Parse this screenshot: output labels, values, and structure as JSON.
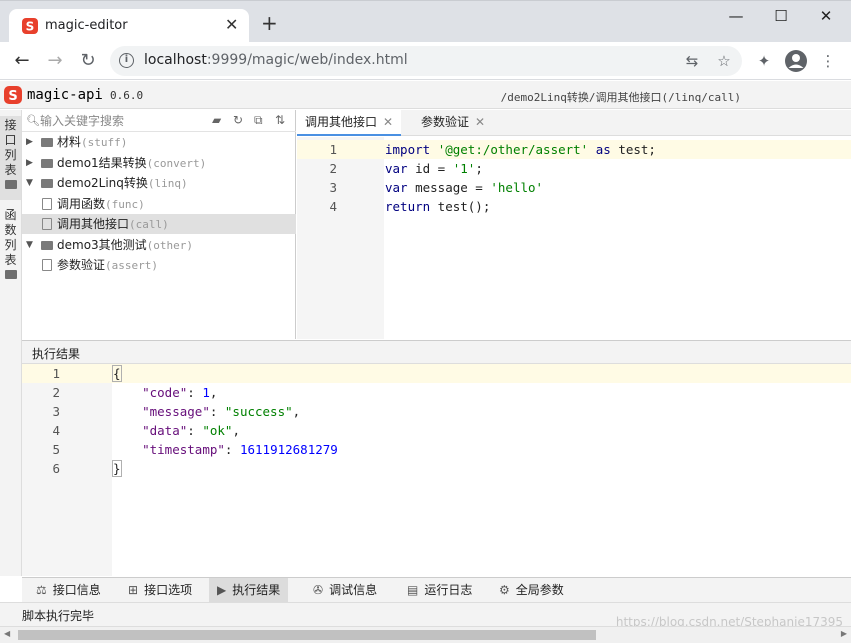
{
  "browser": {
    "tab_title": "magic-editor",
    "tab_close": "✕",
    "new_tab": "+",
    "minimize": "—",
    "maximize": "☐",
    "close": "✕",
    "url_host": "localhost",
    "url_rest": ":9999/magic/web/index.html"
  },
  "app": {
    "name": "magic-api",
    "version": "0.6.0",
    "path": "/demo2Linq转换/调用其他接口(/linq/call)"
  },
  "sidebar": {
    "tab_interfaces": [
      "接",
      "口",
      "列",
      "表"
    ],
    "tab_functions": [
      "函",
      "数",
      "列",
      "表"
    ]
  },
  "tree": {
    "search_placeholder": "输入关键字搜索",
    "items": [
      {
        "label": "材料",
        "sub": "(stuff)",
        "type": "folder",
        "expanded": false,
        "selected": false
      },
      {
        "label": "demo1结果转换",
        "sub": "(convert)",
        "type": "folder",
        "expanded": false,
        "selected": false
      },
      {
        "label": "demo2Linq转换",
        "sub": "(linq)",
        "type": "folder",
        "expanded": true,
        "selected": false
      },
      {
        "label": "调用函数",
        "sub": "(func)",
        "type": "file",
        "expanded": false,
        "selected": false
      },
      {
        "label": "调用其他接口",
        "sub": "(call)",
        "type": "file",
        "expanded": false,
        "selected": true
      },
      {
        "label": "demo3其他测试",
        "sub": "(other)",
        "type": "folder",
        "expanded": true,
        "selected": false
      },
      {
        "label": "参数验证",
        "sub": "(assert)",
        "type": "file",
        "expanded": false,
        "selected": false
      }
    ]
  },
  "editor": {
    "tabs": [
      {
        "label": "调用其他接口",
        "close": "✕",
        "active": true
      },
      {
        "label": "参数验证",
        "close": "✕",
        "active": false
      }
    ],
    "lines": [
      [
        {
          "t": "import ",
          "c": "kw"
        },
        {
          "t": "'@get:/other/assert'",
          "c": "str"
        },
        {
          "t": " ",
          "c": ""
        },
        {
          "t": "as",
          "c": "kw"
        },
        {
          "t": " test;",
          "c": ""
        }
      ],
      [
        {
          "t": "var",
          "c": "kw"
        },
        {
          "t": " id = ",
          "c": ""
        },
        {
          "t": "'1'",
          "c": "str"
        },
        {
          "t": ";",
          "c": ""
        }
      ],
      [
        {
          "t": "var",
          "c": "kw"
        },
        {
          "t": " message = ",
          "c": ""
        },
        {
          "t": "'hello'",
          "c": "str"
        }
      ],
      [
        {
          "t": "return",
          "c": "kw"
        },
        {
          "t": " test();",
          "c": ""
        }
      ]
    ]
  },
  "result": {
    "header": "执行结果",
    "lines": [
      [
        {
          "t": "{",
          "c": "brk"
        }
      ],
      [
        {
          "t": "    ",
          "c": ""
        },
        {
          "t": "\"code\"",
          "c": "key"
        },
        {
          "t": ": ",
          "c": ""
        },
        {
          "t": "1",
          "c": "num"
        },
        {
          "t": ",",
          "c": ""
        }
      ],
      [
        {
          "t": "    ",
          "c": ""
        },
        {
          "t": "\"message\"",
          "c": "key"
        },
        {
          "t": ": ",
          "c": ""
        },
        {
          "t": "\"success\"",
          "c": "str"
        },
        {
          "t": ",",
          "c": ""
        }
      ],
      [
        {
          "t": "    ",
          "c": ""
        },
        {
          "t": "\"data\"",
          "c": "key"
        },
        {
          "t": ": ",
          "c": ""
        },
        {
          "t": "\"ok\"",
          "c": "str"
        },
        {
          "t": ",",
          "c": ""
        }
      ],
      [
        {
          "t": "    ",
          "c": ""
        },
        {
          "t": "\"timestamp\"",
          "c": "key"
        },
        {
          "t": ": ",
          "c": ""
        },
        {
          "t": "1611912681279",
          "c": "num"
        }
      ],
      [
        {
          "t": "}",
          "c": "brk"
        }
      ]
    ]
  },
  "bottom_tabs": [
    {
      "label": "接口信息",
      "icon": "⚖",
      "active": false
    },
    {
      "label": "接口选项",
      "icon": "⊞",
      "active": false
    },
    {
      "label": "执行结果",
      "icon": "▶",
      "active": true
    },
    {
      "label": "调试信息",
      "icon": "✇",
      "active": false
    },
    {
      "label": "运行日志",
      "icon": "▤",
      "active": false
    },
    {
      "label": "全局参数",
      "icon": "⚙",
      "active": false
    }
  ],
  "status": {
    "text": "脚本执行完毕",
    "watermark": "https://blog.csdn.net/Stephanie17395"
  }
}
